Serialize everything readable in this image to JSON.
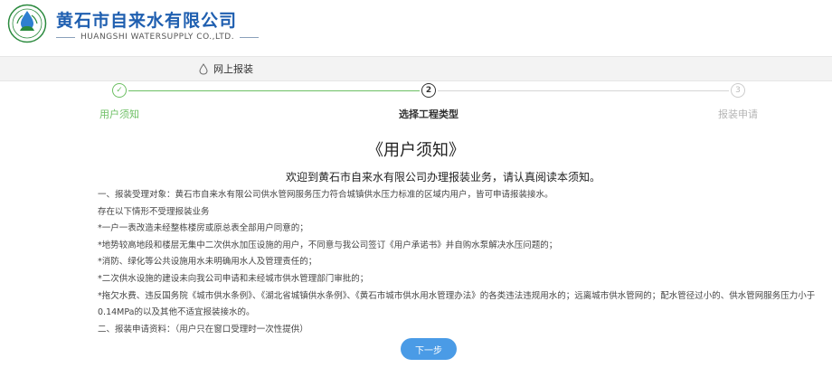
{
  "header": {
    "brand_cn": "黄石市自来水有限公司",
    "brand_en": "HUANGSHI WATERSUPPLY CO.,LTD.",
    "logo_icon": "water-drop-logo-icon",
    "brand_color": "#1f5fb0"
  },
  "nav": {
    "items": [
      {
        "label": "网上报装",
        "icon": "water-drop-icon"
      }
    ]
  },
  "steps": {
    "items": [
      {
        "label": "用户须知",
        "marker": "✓",
        "status": "done"
      },
      {
        "label": "选择工程类型",
        "marker": "2",
        "status": "active"
      },
      {
        "label": "报装申请",
        "marker": "3",
        "status": "todo"
      }
    ],
    "colors": {
      "done": "#6cbf63",
      "active": "#333333",
      "todo": "#b5b5b5"
    }
  },
  "notice": {
    "title": "《用户须知》",
    "welcome": "欢迎到黄石市自来水有限公司办理报装业务，请认真阅读本须知。",
    "lines": [
      "一、报装受理对象：黄石市自来水有限公司供水管网服务压力符合城镇供水压力标准的区域内用户，皆可申请报装接水。",
      "存在以下情形不受理报装业务",
      "*一户一表改造未经整栋楼房或原总表全部用户同意的；",
      "*地势较高地段和楼层无集中二次供水加压设施的用户，不同意与我公司签订《用户承诺书》并自购水泵解决水压问题的；",
      "*消防、绿化等公共设施用水未明确用水人及管理责任的；",
      "*二次供水设施的建设未向我公司申请和未经城市供水管理部门审批的；",
      "*拖欠水费、违反国务院《城市供水条例》、《湖北省城镇供水条例》、《黄石市城市供水用水管理办法》的各类违法违规用水的；远离城市供水管网的；配水管径过小的、供水管网服务压力小于0.14MPa的以及其他不适宜报装接水的。",
      "二、报装申请资料：（用户只在窗口受理时一次性提供）"
    ]
  },
  "actions": {
    "next_label": "下一步",
    "button_color": "#4a9be6"
  }
}
